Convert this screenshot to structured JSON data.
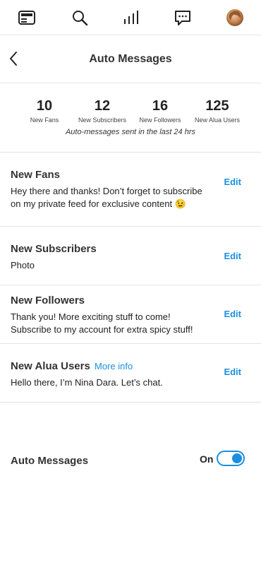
{
  "nav": {
    "icons": [
      "feed-icon",
      "search-icon",
      "stats-icon",
      "messages-icon",
      "avatar"
    ]
  },
  "header": {
    "title": "Auto Messages"
  },
  "stats": {
    "items": [
      {
        "value": "10",
        "label": "New Fans"
      },
      {
        "value": "12",
        "label": "New Subscribers"
      },
      {
        "value": "16",
        "label": "New Followers"
      },
      {
        "value": "125",
        "label": "New Alua Users"
      }
    ],
    "caption": "Auto-messages sent in the last 24 hrs"
  },
  "messages": [
    {
      "title": "New Fans",
      "body_line1": "Hey there and thanks! Don’t forget to subscribe",
      "body_line2": "on my private feed for exclusive content 😉",
      "edit_label": "Edit"
    },
    {
      "title": "New Subscribers",
      "body_line1": "Photo",
      "edit_label": "Edit"
    },
    {
      "title": "New Followers",
      "body_line1": "Thank you! More exciting stuff to come!",
      "body_line2": "Subscribe to my account for extra spicy stuff!",
      "edit_label": "Edit"
    },
    {
      "title": "New Alua Users",
      "more_info": "More info",
      "body_line1": "Hello there, I’m Nina Dara. Let’s chat.",
      "edit_label": "Edit"
    }
  ],
  "auto_messages": {
    "label": "Auto Messages",
    "state": "On",
    "enabled": true
  },
  "colors": {
    "accent": "#1a8fe0",
    "divider": "#e2e2e2",
    "text": "#222222"
  }
}
